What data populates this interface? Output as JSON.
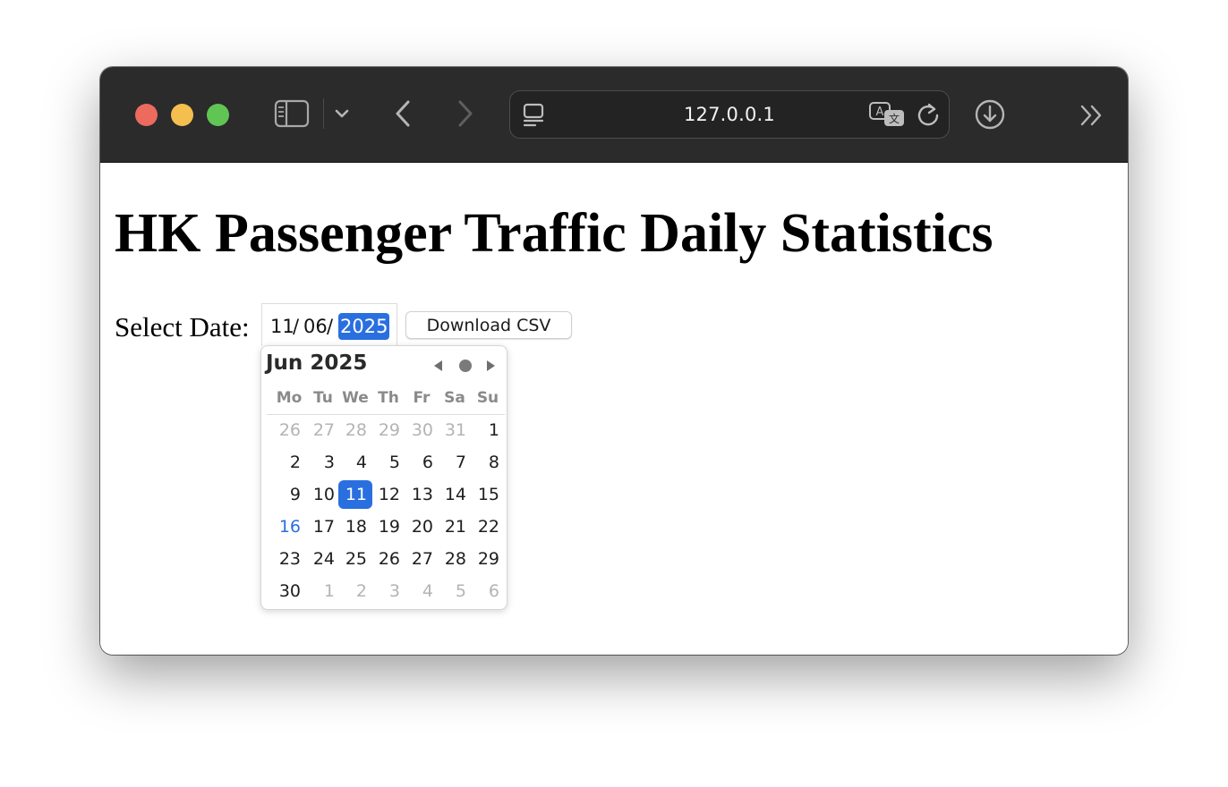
{
  "browser": {
    "url": "127.0.0.1",
    "icons": {
      "sidebar": "sidebar-icon",
      "sidebar_menu": "chevron-down-icon",
      "back": "chevron-left-icon",
      "forward": "chevron-right-icon",
      "reader": "reader-icon",
      "translate": "translate-icon",
      "reload": "reload-icon",
      "download": "download-icon",
      "more": "double-chevron-right-icon"
    }
  },
  "page": {
    "title": "HK Passenger Traffic Daily Statistics",
    "date_label": "Select Date:",
    "date_input": {
      "day": "11",
      "month": "06",
      "year": "2025",
      "separator": "/",
      "focused_segment": "year"
    },
    "download_button": "Download CSV"
  },
  "calendar": {
    "month_title": "Jun 2025",
    "weekdays": [
      "Mo",
      "Tu",
      "We",
      "Th",
      "Fr",
      "Sa",
      "Su"
    ],
    "weeks": [
      [
        {
          "d": "26",
          "o": true
        },
        {
          "d": "27",
          "o": true
        },
        {
          "d": "28",
          "o": true
        },
        {
          "d": "29",
          "o": true
        },
        {
          "d": "30",
          "o": true
        },
        {
          "d": "31",
          "o": true
        },
        {
          "d": "1"
        }
      ],
      [
        {
          "d": "2"
        },
        {
          "d": "3"
        },
        {
          "d": "4"
        },
        {
          "d": "5"
        },
        {
          "d": "6"
        },
        {
          "d": "7"
        },
        {
          "d": "8"
        }
      ],
      [
        {
          "d": "9"
        },
        {
          "d": "10"
        },
        {
          "d": "11",
          "sel": true
        },
        {
          "d": "12"
        },
        {
          "d": "13"
        },
        {
          "d": "14"
        },
        {
          "d": "15"
        }
      ],
      [
        {
          "d": "16",
          "today": true
        },
        {
          "d": "17"
        },
        {
          "d": "18"
        },
        {
          "d": "19"
        },
        {
          "d": "20"
        },
        {
          "d": "21"
        },
        {
          "d": "22"
        }
      ],
      [
        {
          "d": "23"
        },
        {
          "d": "24"
        },
        {
          "d": "25"
        },
        {
          "d": "26"
        },
        {
          "d": "27"
        },
        {
          "d": "28"
        },
        {
          "d": "29"
        }
      ],
      [
        {
          "d": "30"
        },
        {
          "d": "1",
          "o": true
        },
        {
          "d": "2",
          "o": true
        },
        {
          "d": "3",
          "o": true
        },
        {
          "d": "4",
          "o": true
        },
        {
          "d": "5",
          "o": true
        },
        {
          "d": "6",
          "o": true
        }
      ]
    ],
    "selected_day": "11",
    "today_day": "16",
    "colors": {
      "accent": "#2a6fe0",
      "other_month": "#b4b4b4"
    }
  }
}
